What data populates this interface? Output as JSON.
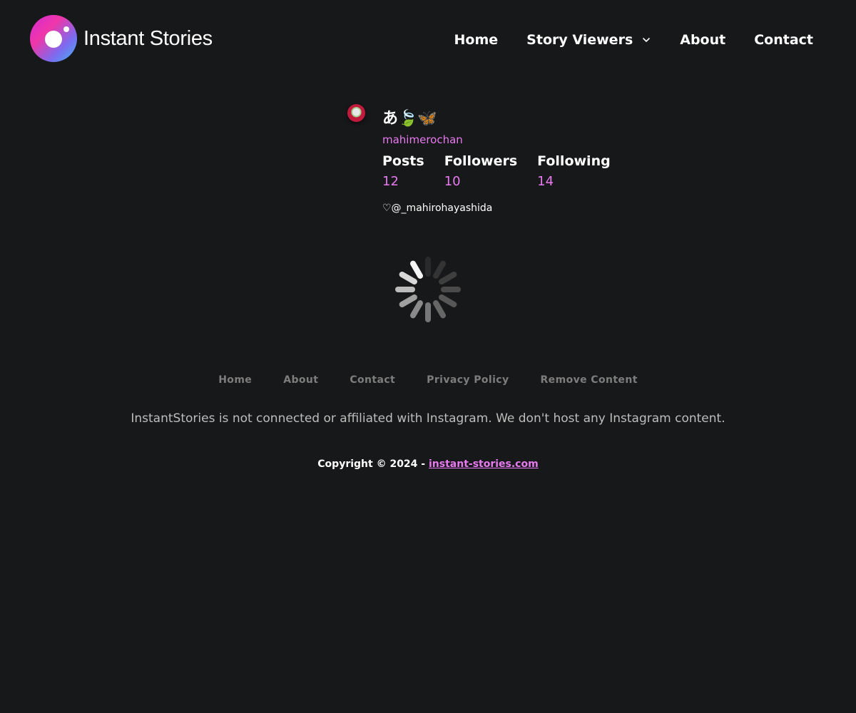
{
  "header": {
    "brand": {
      "name": "Instant Stories",
      "logo_icon": "camera-lens-logo-icon"
    },
    "nav": [
      {
        "label": "Home"
      },
      {
        "label": "Story Viewers",
        "has_dropdown": true
      },
      {
        "label": "About"
      },
      {
        "label": "Contact"
      }
    ]
  },
  "profile": {
    "display_name": "あ🍃🦋",
    "username": "mahimerochan",
    "stats": [
      {
        "label": "Posts",
        "value": "12"
      },
      {
        "label": "Followers",
        "value": "10"
      },
      {
        "label": "Following",
        "value": "14"
      }
    ],
    "bio": "♡@_mahirohayashida"
  },
  "loading": {
    "spinner_icon": "loading-spinner-icon"
  },
  "footer": {
    "links": [
      {
        "label": "Home"
      },
      {
        "label": "About"
      },
      {
        "label": "Contact"
      },
      {
        "label": "Privacy Policy"
      },
      {
        "label": "Remove Content"
      }
    ],
    "disclaimer": "InstantStories is not connected or affiliated with Instagram. We don't host any Instagram content.",
    "copyright_prefix": "Copyright © 2024 - ",
    "copyright_link": "instant-stories.com"
  },
  "colors": {
    "background": "#17181a",
    "accent": "#e879f0",
    "footer_link": "#7d7d7d",
    "disclaimer": "#bdbdbd"
  }
}
